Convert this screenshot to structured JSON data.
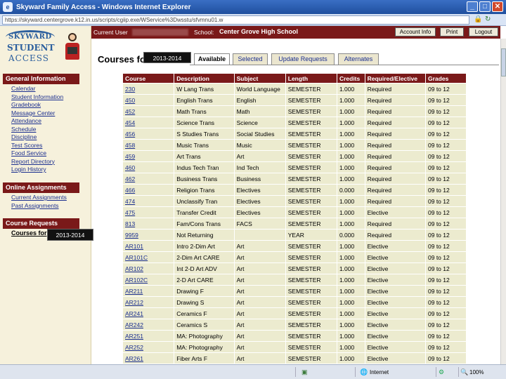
{
  "window": {
    "title": "Skyward Family Access - Windows Internet Explorer",
    "app_icon": "ie-icon",
    "minimize": "_",
    "maximize": "□",
    "close": "✕"
  },
  "address": {
    "url": "https://skyward.centergrove.k12.in.us/scripts/cgiip.exe/WService%3Dwsstu/sfvmnu01.w"
  },
  "header": {
    "current_user_label": "Current User",
    "school_label": "School:",
    "school_name": "Center Grove High School",
    "buttons": [
      "Account Info",
      "Print",
      "Logout"
    ]
  },
  "logo": {
    "line1": "SKYWARD",
    "line2": "STUDENT",
    "line3": "ACCESS"
  },
  "sidebar": {
    "general": {
      "title": "General Information",
      "items": [
        "Calendar",
        "Student Information",
        "Gradebook",
        "Message Center",
        "Attendance",
        "Schedule",
        "Discipline",
        "Test Scores",
        "Food Service",
        "Report Directory",
        "Login History"
      ]
    },
    "online": {
      "title": "Online Assignments",
      "items": [
        "Current Assignments",
        "Past Assignments"
      ]
    },
    "requests": {
      "title": "Course Requests",
      "current": "Courses for",
      "year_badge": "2013-2014"
    }
  },
  "page": {
    "heading": "Courses for",
    "year_badge": "2013-2014",
    "tabs": [
      "Available",
      "Selected",
      "Update Requests",
      "Alternates"
    ],
    "active_tab": "Available"
  },
  "table": {
    "headers": [
      "Course",
      "Description",
      "Subject",
      "Length",
      "Credits",
      "Required/Elective",
      "Grades"
    ],
    "rows": [
      [
        "230",
        "W Lang Trans",
        "World Language",
        "SEMESTER",
        "1.000",
        "Required",
        "09 to 12"
      ],
      [
        "450",
        "English Trans",
        "English",
        "SEMESTER",
        "1.000",
        "Required",
        "09 to 12"
      ],
      [
        "452",
        "Math Trans",
        "Math",
        "SEMESTER",
        "1.000",
        "Required",
        "09 to 12"
      ],
      [
        "454",
        "Science Trans",
        "Science",
        "SEMESTER",
        "1.000",
        "Required",
        "09 to 12"
      ],
      [
        "456",
        "S Studies Trans",
        "Social Studies",
        "SEMESTER",
        "1.000",
        "Required",
        "09 to 12"
      ],
      [
        "458",
        "Music Trans",
        "Music",
        "SEMESTER",
        "1.000",
        "Required",
        "09 to 12"
      ],
      [
        "459",
        "Art Trans",
        "Art",
        "SEMESTER",
        "1.000",
        "Required",
        "09 to 12"
      ],
      [
        "460",
        "Indus Tech Tran",
        "Ind Tech",
        "SEMESTER",
        "1.000",
        "Required",
        "09 to 12"
      ],
      [
        "462",
        "Business Trans",
        "Business",
        "SEMESTER",
        "1.000",
        "Required",
        "09 to 12"
      ],
      [
        "466",
        "Religion Trans",
        "Electives",
        "SEMESTER",
        "0.000",
        "Required",
        "09 to 12"
      ],
      [
        "474",
        "Unclassify Tran",
        "Electives",
        "SEMESTER",
        "1.000",
        "Required",
        "09 to 12"
      ],
      [
        "475",
        "Transfer Credit",
        "Electives",
        "SEMESTER",
        "1.000",
        "Elective",
        "09 to 12"
      ],
      [
        "813",
        "Fam/Cons Trans",
        "FACS",
        "SEMESTER",
        "1.000",
        "Required",
        "09 to 12"
      ],
      [
        "9959",
        "Not Returning",
        "",
        "YEAR",
        "0.000",
        "Required",
        "09 to 12"
      ],
      [
        "AR101",
        "Intro 2-Dim Art",
        "Art",
        "SEMESTER",
        "1.000",
        "Elective",
        "09 to 12"
      ],
      [
        "AR101C",
        "2-Dim Art CARE",
        "Art",
        "SEMESTER",
        "1.000",
        "Elective",
        "09 to 12"
      ],
      [
        "AR102",
        "Int 2-D Art ADV",
        "Art",
        "SEMESTER",
        "1.000",
        "Elective",
        "09 to 12"
      ],
      [
        "AR102C",
        "2-D Art CARE",
        "Art",
        "SEMESTER",
        "1.000",
        "Elective",
        "09 to 12"
      ],
      [
        "AR211",
        "Drawing F",
        "Art",
        "SEMESTER",
        "1.000",
        "Elective",
        "09 to 12"
      ],
      [
        "AR212",
        "Drawing S",
        "Art",
        "SEMESTER",
        "1.000",
        "Elective",
        "09 to 12"
      ],
      [
        "AR241",
        "Ceramics F",
        "Art",
        "SEMESTER",
        "1.000",
        "Elective",
        "09 to 12"
      ],
      [
        "AR242",
        "Ceramics S",
        "Art",
        "SEMESTER",
        "1.000",
        "Elective",
        "09 to 12"
      ],
      [
        "AR251",
        "MA: Photography",
        "Art",
        "SEMESTER",
        "1.000",
        "Elective",
        "09 to 12"
      ],
      [
        "AR252",
        "MA: Photography",
        "Art",
        "SEMESTER",
        "1.000",
        "Elective",
        "09 to 12"
      ],
      [
        "AR261",
        "Fiber Arts F",
        "Art",
        "SEMESTER",
        "1.000",
        "Elective",
        "09 to 12"
      ]
    ]
  },
  "status": {
    "zone": "Internet",
    "zoom": "100%",
    "globe_icon": "globe-icon",
    "zoom_icon": "zoom-icon"
  },
  "colors": {
    "maroon": "#7a1919",
    "cell": "#ecebcf",
    "sidebar": "#f6f1dc",
    "link": "#1b2f8f"
  }
}
